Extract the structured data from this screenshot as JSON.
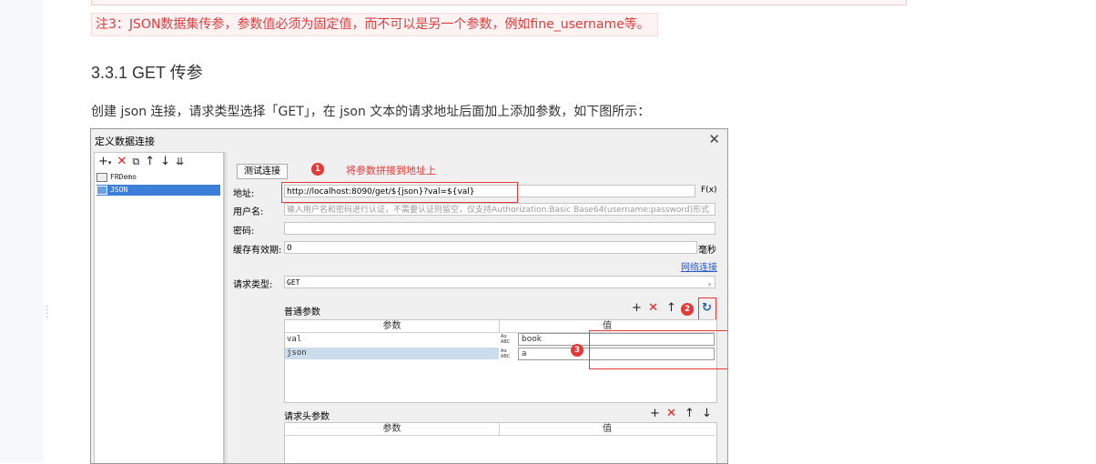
{
  "note": "注3：JSON数据集传参，参数值必须为固定值，而不可以是另一个参数，例如fine_username等。",
  "heading": "3.3.1 GET 传参",
  "paragraph": "创建 json 连接，请求类型选择「GET」，在 json 文本的请求地址后面加上添加参数，如下图所示：",
  "dialog": {
    "title": "定义数据连接",
    "tree": [
      "FRDemo",
      "JSON"
    ],
    "test_button": "测试连接",
    "annotation_1": "将参数拼接到地址上",
    "badges": [
      "1",
      "2",
      "3"
    ],
    "fields": {
      "address_label": "地址:",
      "address_value": "http://localhost:8090/get/${json}?val=${val}",
      "formula_label": "F(x)",
      "username_label": "用户名:",
      "username_placeholder": "输入用户名和密码进行认证，不需要认证则留空，仅支持Authorization:Basic Base64(username:password)形式",
      "password_label": "密码:",
      "cache_label": "缓存有效期:",
      "cache_value": "0",
      "cache_unit": "毫秒",
      "network_link": "网络连接",
      "request_type_label": "请求类型:",
      "request_type_value": "GET"
    },
    "params": {
      "title": "普通参数",
      "col_param": "参数",
      "col_value": "值",
      "rows": [
        {
          "name": "val",
          "value": "book"
        },
        {
          "name": "json",
          "value": "a"
        }
      ]
    },
    "headers": {
      "title": "请求头参数",
      "col_param": "参数",
      "col_value": "值"
    }
  }
}
